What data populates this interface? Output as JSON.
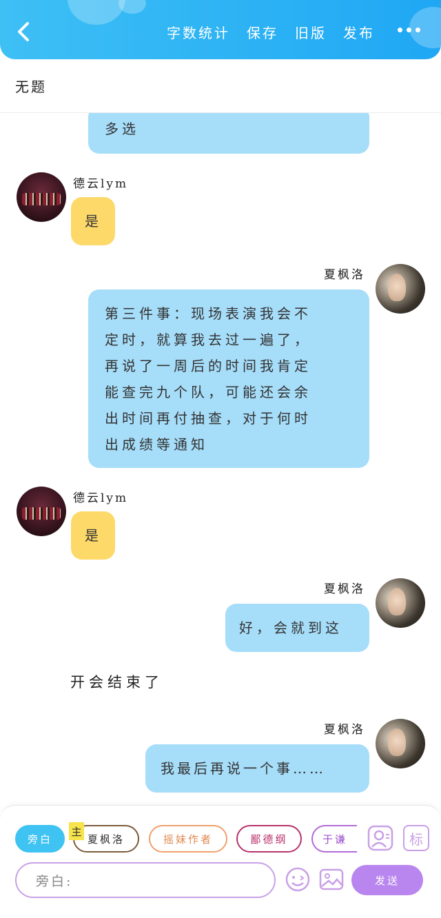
{
  "header": {
    "actions": [
      "字数统计",
      "保存",
      "旧版",
      "发布"
    ]
  },
  "document": {
    "title": "无题"
  },
  "messages": [
    {
      "type": "right-bubble",
      "text": "多选"
    },
    {
      "type": "left",
      "name": "德云lym",
      "text": "是"
    },
    {
      "type": "right",
      "name": "夏枫洛",
      "lines": [
        "第三件事：现场表演我会不",
        "定时，就算我去过一遍了，",
        "再说了一周后的时间我肯定",
        "能查完九个队，可能还会余",
        "出时间再付抽查，对于何时",
        "出成绩等通知"
      ]
    },
    {
      "type": "left",
      "name": "德云lym",
      "text": "是"
    },
    {
      "type": "right",
      "name": "夏枫洛",
      "text": "好，会就到这"
    },
    {
      "type": "narration",
      "text": "开会结束了"
    },
    {
      "type": "right",
      "name": "夏枫洛",
      "text": "我最后再说一个事……"
    }
  ],
  "toolbar": {
    "chips": [
      "旁白",
      "夏枫洛",
      "摇妹作者",
      "鄙德纲",
      "于谦"
    ],
    "host_tag": "主",
    "input_placeholder": "旁白:",
    "send_label": "发送",
    "mark_label": "标"
  },
  "colors": {
    "header": "#1fa7f4",
    "blue_bubble": "#a6ddf9",
    "yellow_bubble": "#fdd96a",
    "send": "#b985ee"
  }
}
